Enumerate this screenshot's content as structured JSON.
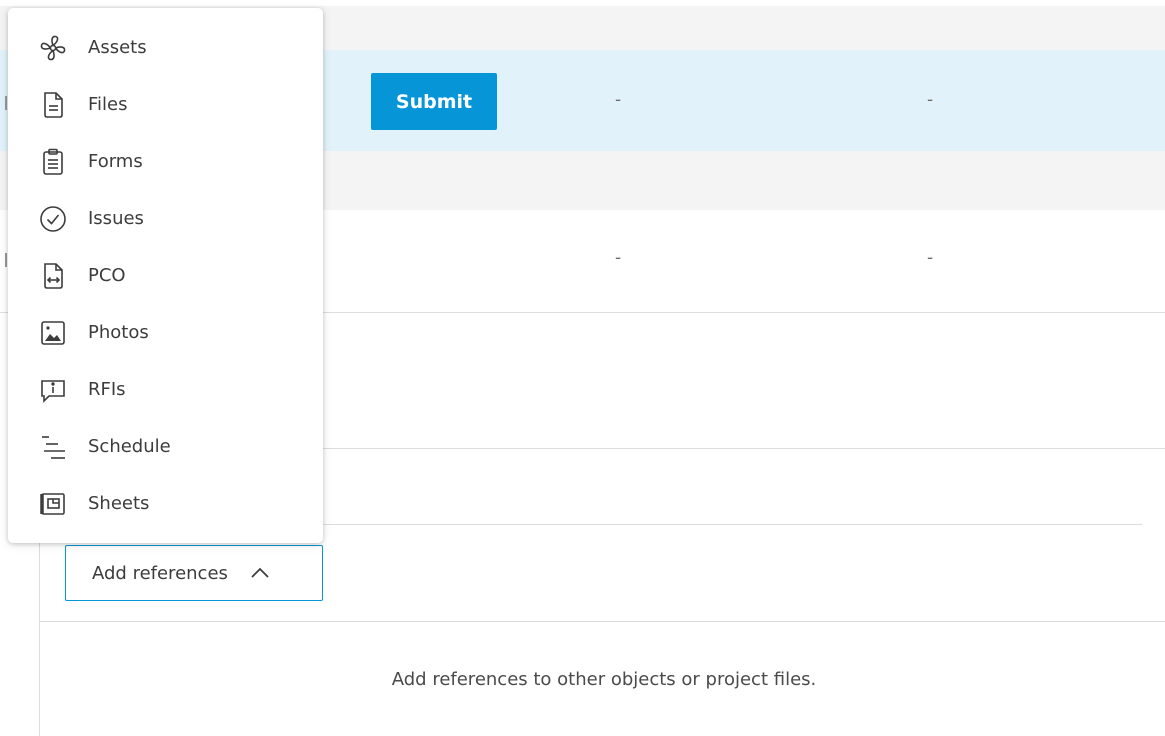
{
  "table": {
    "rows": [
      {
        "action_label": "Submit",
        "col2": "-",
        "col3": "-"
      },
      {
        "col2": "-",
        "col3": "-"
      }
    ],
    "submit_color": "#0696d7",
    "selected_row_color": "#e2f2fa"
  },
  "references": {
    "add_button_label": "Add references",
    "empty_message": "Add references to other objects or project files.",
    "menu_items": [
      {
        "label": "Assets",
        "icon": "assets-icon"
      },
      {
        "label": "Files",
        "icon": "file-icon"
      },
      {
        "label": "Forms",
        "icon": "form-icon"
      },
      {
        "label": "Issues",
        "icon": "issue-check-icon"
      },
      {
        "label": "PCO",
        "icon": "pco-icon"
      },
      {
        "label": "Photos",
        "icon": "photo-icon"
      },
      {
        "label": "RFIs",
        "icon": "rfi-icon"
      },
      {
        "label": "Schedule",
        "icon": "schedule-icon"
      },
      {
        "label": "Sheets",
        "icon": "sheet-icon"
      }
    ]
  }
}
